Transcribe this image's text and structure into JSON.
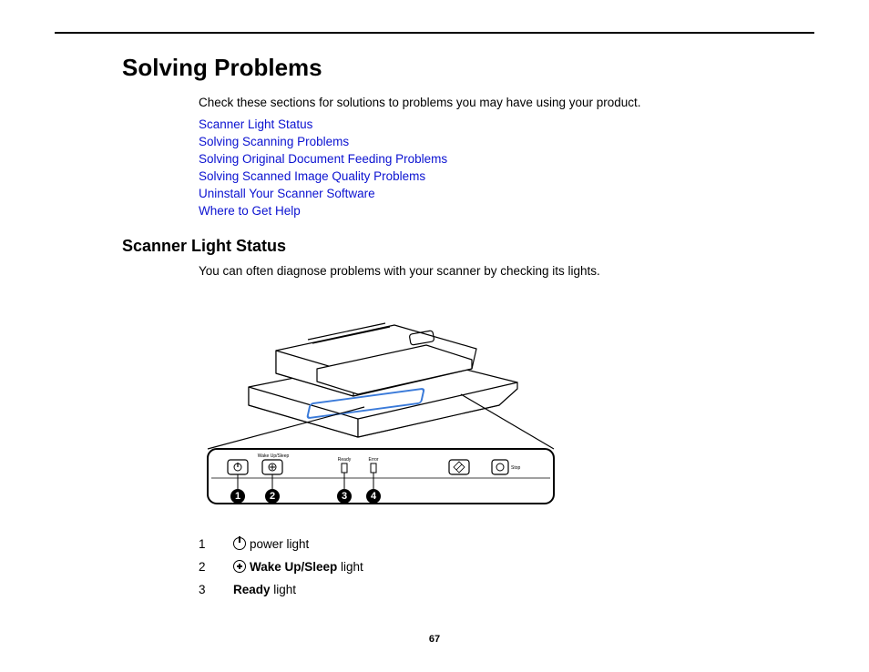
{
  "h1": "Solving Problems",
  "intro": "Check these sections for solutions to problems you may have using your product.",
  "links": [
    "Scanner Light Status",
    "Solving Scanning Problems",
    "Solving Original Document Feeding Problems",
    "Solving Scanned Image Quality Problems",
    "Uninstall Your Scanner Software",
    "Where to Get Help"
  ],
  "h2": "Scanner Light Status",
  "section_intro": "You can often diagnose problems with your scanner by checking its lights.",
  "panel": {
    "wake_label": "Wake Up/Sleep",
    "ready_label": "Ready",
    "error_label": "Error",
    "stop_label": "Stop",
    "callouts": [
      "1",
      "2",
      "3",
      "4"
    ]
  },
  "legend": [
    {
      "num": "1",
      "icon": "power",
      "bold": "",
      "text": " power light"
    },
    {
      "num": "2",
      "icon": "wake",
      "bold": "Wake Up/Sleep",
      "text": " light"
    },
    {
      "num": "3",
      "icon": "",
      "bold": "Ready",
      "text": " light"
    }
  ],
  "page_number": "67"
}
